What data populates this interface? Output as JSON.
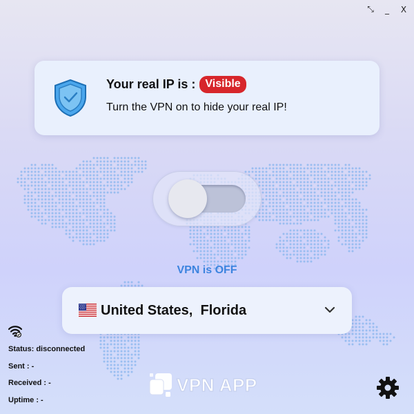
{
  "window": {
    "restore_glyph": "⤡",
    "minimize_glyph": "_",
    "close_glyph": "X"
  },
  "ip_card": {
    "title": "Your real IP is :",
    "badge": "Visible",
    "subtitle": "Turn the VPN on to hide your real IP!",
    "icon": "shield-check-icon"
  },
  "toggle": {
    "state": "off"
  },
  "vpn_status": "VPN is OFF",
  "location": {
    "label": "United States,  Florida",
    "flag": "us-flag-icon"
  },
  "connection": {
    "status": "Status: disconnected",
    "sent": "Sent : -",
    "received": "Received : -",
    "uptime": "Uptime : -"
  },
  "brand": {
    "name": "VPN APP"
  },
  "colors": {
    "badge_red": "#d7262b",
    "status_blue": "#3d84df",
    "shield_blue": "#4aa6ec",
    "map_dot": "#8fb8ef"
  }
}
